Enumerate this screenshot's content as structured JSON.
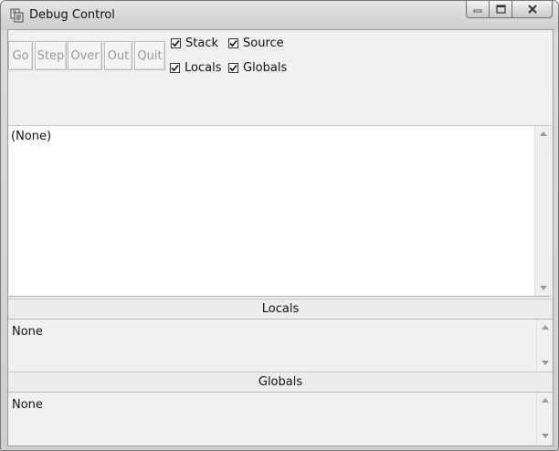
{
  "window": {
    "title": "Debug Control",
    "icon": "python-icon"
  },
  "toolbar": {
    "buttons": [
      {
        "label": "Go"
      },
      {
        "label": "Step"
      },
      {
        "label": "Over"
      },
      {
        "label": "Out"
      },
      {
        "label": "Quit"
      }
    ],
    "checkboxes": [
      {
        "label": "Stack",
        "checked": true
      },
      {
        "label": "Source",
        "checked": true
      },
      {
        "label": "Locals",
        "checked": true
      },
      {
        "label": "Globals",
        "checked": true
      }
    ]
  },
  "stack": {
    "content": "(None)"
  },
  "locals": {
    "heading": "Locals",
    "content": "None"
  },
  "globals": {
    "heading": "Globals",
    "content": "None"
  }
}
